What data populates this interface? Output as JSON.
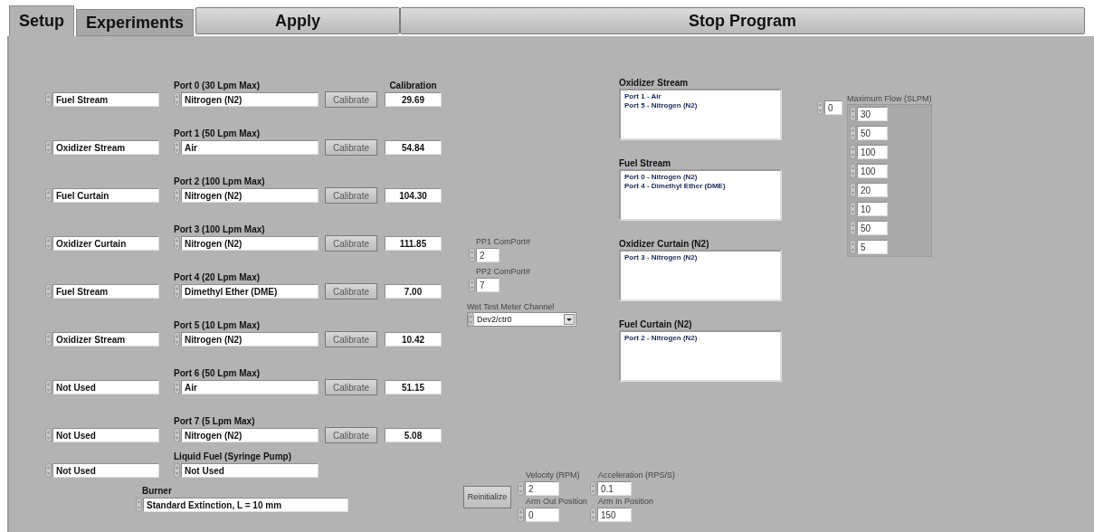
{
  "tabs": [
    {
      "label": "Setup",
      "selected": true
    },
    {
      "label": "Experiments",
      "selected": false
    }
  ],
  "toolbar_buttons": [
    {
      "label": "Apply"
    },
    {
      "label": "Stop Program"
    }
  ],
  "calibration_header": "Calibration",
  "ports": [
    {
      "stream": "Fuel Stream",
      "label": "Port 0 (30 Lpm Max)",
      "gas": "Nitrogen (N2)",
      "button": "Calibrate",
      "calibration": "29.69"
    },
    {
      "stream": "Oxidizer Stream",
      "label": "Port 1 (50 Lpm Max)",
      "gas": "Air",
      "button": "Calibrate",
      "calibration": "54.84"
    },
    {
      "stream": "Fuel Curtain",
      "label": "Port 2 (100 Lpm Max)",
      "gas": "Nitrogen (N2)",
      "button": "Calibrate",
      "calibration": "104.30"
    },
    {
      "stream": "Oxidizer Curtain",
      "label": "Port 3 (100 Lpm Max)",
      "gas": "Nitrogen (N2)",
      "button": "Calibrate",
      "calibration": "111.85"
    },
    {
      "stream": "Fuel Stream",
      "label": "Port 4 (20 Lpm Max)",
      "gas": "Dimethyl Ether (DME)",
      "button": "Calibrate",
      "calibration": "7.00"
    },
    {
      "stream": "Oxidizer Stream",
      "label": "Port 5 (10 Lpm Max)",
      "gas": "Nitrogen (N2)",
      "button": "Calibrate",
      "calibration": "10.42"
    },
    {
      "stream": "Not Used",
      "label": "Port 6 (50 Lpm Max)",
      "gas": "Air",
      "button": "Calibrate",
      "calibration": "51.15"
    },
    {
      "stream": "Not Used",
      "label": "Port 7 (5 Lpm Max)",
      "gas": "Nitrogen (N2)",
      "button": "Calibrate",
      "calibration": "5.08"
    }
  ],
  "liquid_fuel": {
    "stream": "Not Used",
    "label": "Liquid Fuel (Syringe Pump)",
    "value": "Not Used"
  },
  "burner": {
    "label": "Burner",
    "value": "Standard Extinction, L = 10 mm"
  },
  "comports": [
    {
      "label": "PP1 ComPort#",
      "value": "2"
    },
    {
      "label": "PP2 ComPort#",
      "value": "7"
    }
  ],
  "wet_test_meter": {
    "label": "Wet Test Meter Channel",
    "value": "Dev2/ctr0"
  },
  "streams": [
    {
      "title": "Oxidizer Stream",
      "items": [
        "Port 1 - Air",
        "Port 5 - Nitrogen (N2)"
      ]
    },
    {
      "title": "Fuel Stream",
      "items": [
        "Port 0 - Nitrogen (N2)",
        "Port 4 - Dimethyl Ether (DME)"
      ]
    },
    {
      "title": "Oxidizer Curtain (N2)",
      "items": [
        "Port 3 - Nitrogen (N2)"
      ]
    },
    {
      "title": "Fuel Curtain (N2)",
      "items": [
        "Port 2 - Nitrogen (N2)"
      ]
    }
  ],
  "max_flow": {
    "label": "Maximum Flow (SLPM)",
    "index": "0",
    "values": [
      "30",
      "50",
      "100",
      "100",
      "20",
      "10",
      "50",
      "5"
    ]
  },
  "motor": {
    "button": "Reinitialize",
    "fields": [
      {
        "label": "Velocity (RPM)",
        "value": "2"
      },
      {
        "label": "Acceleration (RPS/S)",
        "value": "0.1"
      },
      {
        "label": "Arm Out Position",
        "value": "0"
      },
      {
        "label": "Arm In Position",
        "value": "150"
      }
    ]
  }
}
